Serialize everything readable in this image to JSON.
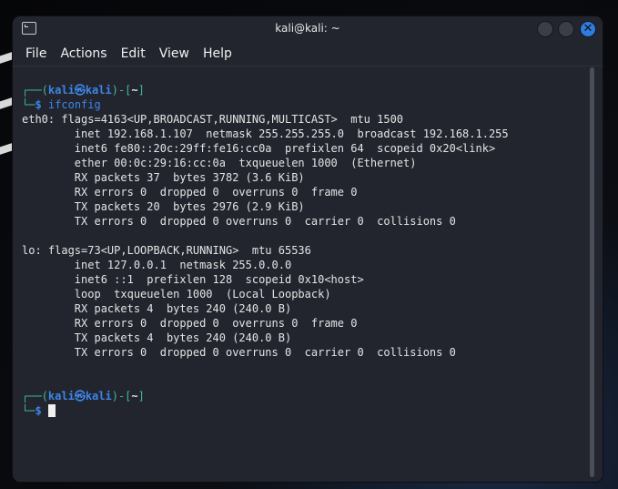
{
  "window": {
    "title": "kali@kali: ~"
  },
  "menu": [
    "File",
    "Actions",
    "Edit",
    "View",
    "Help"
  ],
  "prompt": {
    "user": "kali",
    "host": "kali",
    "dir": "~",
    "symbol": "$"
  },
  "command": "ifconfig",
  "output": [
    "eth0: flags=4163<UP,BROADCAST,RUNNING,MULTICAST>  mtu 1500",
    "        inet 192.168.1.107  netmask 255.255.255.0  broadcast 192.168.1.255",
    "        inet6 fe80::20c:29ff:fe16:cc0a  prefixlen 64  scopeid 0x20<link>",
    "        ether 00:0c:29:16:cc:0a  txqueuelen 1000  (Ethernet)",
    "        RX packets 37  bytes 3782 (3.6 KiB)",
    "        RX errors 0  dropped 0  overruns 0  frame 0",
    "        TX packets 20  bytes 2976 (2.9 KiB)",
    "        TX errors 0  dropped 0 overruns 0  carrier 0  collisions 0",
    "",
    "lo: flags=73<UP,LOOPBACK,RUNNING>  mtu 65536",
    "        inet 127.0.0.1  netmask 255.0.0.0",
    "        inet6 ::1  prefixlen 128  scopeid 0x10<host>",
    "        loop  txqueuelen 1000  (Local Loopback)",
    "        RX packets 4  bytes 240 (240.0 B)",
    "        RX errors 0  dropped 0  overruns 0  frame 0",
    "        TX packets 4  bytes 240 (240.0 B)",
    "        TX errors 0  dropped 0 overruns 0  carrier 0  collisions 0",
    "",
    ""
  ],
  "colors": {
    "accent": "#3d86e8",
    "prompt_frame": "#3fb7a2",
    "bg": "#22252e"
  }
}
